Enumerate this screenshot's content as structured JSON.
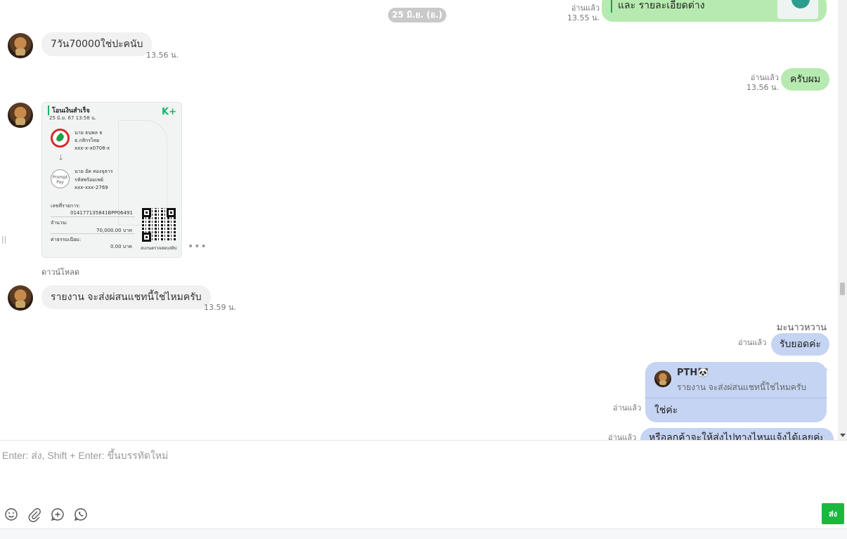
{
  "chat": {
    "date_pill": "25 มิ.ย. (อ.)",
    "top_out": {
      "text": "และ รายละเอียดต่าง",
      "read": "อ่านแล้ว",
      "time": "13.55 น."
    },
    "msg1": {
      "text": "7วัน70000ใช่ปะคนับ",
      "time": "13.56 น."
    },
    "msg2": {
      "text": "ครับผม",
      "read": "อ่านแล้ว",
      "time": "13.56 น."
    },
    "receipt": {
      "title": "โอนเงินสำเร็จ",
      "date": "25 มิ.ย. 67  13:58 น.",
      "brand": "K",
      "brand_plus": "+",
      "from_name": "นาย ธนพล ธ",
      "from_bank": "ธ.กสิกรไทย",
      "from_acct": "xxx-x-x0708-x",
      "pp_label": "Prompt Pay",
      "to_name": "นาย อัค ทองจุลาร",
      "to_type": "รหัสพร้อมเพย์",
      "to_acct": "xxx-xxx-2769",
      "ref_label": "เลขที่รายการ:",
      "ref_value": "014177135841BPP06491",
      "amount_label": "จำนวน:",
      "amount_value": "70,000.00 บาท",
      "fee_label": "ค่าธรรมเนียม:",
      "fee_value": "0.00 บาท",
      "qr_caption": "สแกนตรวจสอบสลิป",
      "download": "ดาวน์โหลด",
      "more": "•••"
    },
    "msg3": {
      "text": "รายงาน จะส่งผ่สนแชทนี้ใช่ไหมครับ",
      "time": "13.59 น."
    },
    "sender_name": "มะนาวหวาน",
    "msg4": {
      "text": "รับยอดค่ะ",
      "read": "อ่านแล้ว"
    },
    "reply": {
      "name": "PTH🐼",
      "quote": "รายงาน จะส่งผ่สนแชทนี้ใช่ไหมครับ",
      "text": "ใช่ค่ะ",
      "read": "อ่านแล้ว"
    },
    "msg5": {
      "text": "หรือลูกค้าจะให้ส่งไปทางไหนแจ้งได้เลยค่ะ",
      "read": "อ่านแล้ว"
    }
  },
  "composer": {
    "placeholder": "Enter: ส่ง, Shift + Enter: ขึ้นบรรทัดใหม่",
    "send_label": "ส่ง",
    "icons": [
      "smiley-icon",
      "paperclip-icon",
      "add-circle-icon",
      "whatsapp-icon"
    ]
  },
  "colors": {
    "outgoing": "#b7eab0",
    "incoming": "#f1f1f1",
    "reply": "#c5d4f3",
    "send": "#1ab83d"
  }
}
